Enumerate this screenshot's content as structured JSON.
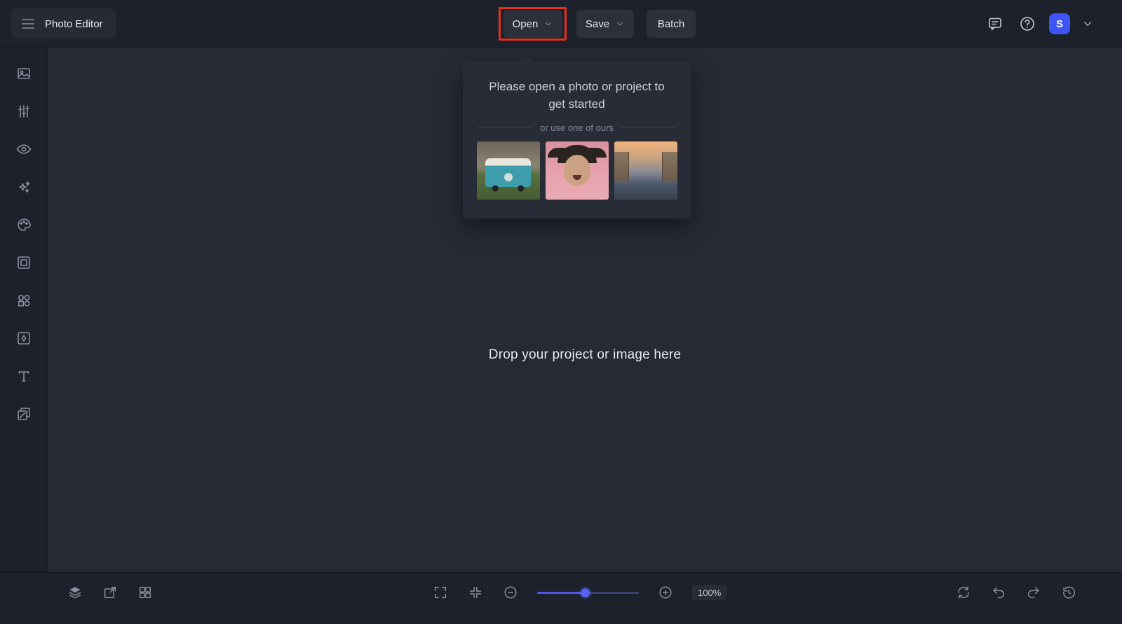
{
  "colors": {
    "topbar_bg": "#1d212b",
    "canvas_bg": "#262a34",
    "popup_bg": "#272c37",
    "button_bg": "#2b303b",
    "accent_blue": "#4a57e8",
    "avatar_blue": "#3d55f2",
    "annotation_red": "#e72f1d",
    "text_primary": "#e7e9ee",
    "text_muted": "#858b99",
    "icon_color": "#7d8492"
  },
  "header": {
    "app_title": "Photo Editor",
    "open_button": "Open",
    "save_button": "Save",
    "batch_button": "Batch",
    "avatar_letter": "S",
    "icons": [
      "hamburger-icon",
      "chevron-down-icon",
      "feedback-icon",
      "help-icon",
      "account-chevron-icon"
    ]
  },
  "sidebar": {
    "tools": [
      {
        "name": "image-tool",
        "icon": "image-icon"
      },
      {
        "name": "adjust-tool",
        "icon": "sliders-icon"
      },
      {
        "name": "retouch-tool",
        "icon": "eye-icon"
      },
      {
        "name": "effects-tool",
        "icon": "sparkles-icon"
      },
      {
        "name": "paint-tool",
        "icon": "palette-icon"
      },
      {
        "name": "frame-tool",
        "icon": "frame-icon"
      },
      {
        "name": "elements-tool",
        "icon": "shapes-icon"
      },
      {
        "name": "filter-tool",
        "icon": "photo-effect-icon"
      },
      {
        "name": "text-tool",
        "icon": "text-icon"
      },
      {
        "name": "layers-tool",
        "icon": "duplicate-icon"
      }
    ]
  },
  "popup": {
    "message": "Please open a photo or project to get started",
    "divider_label": "or use one of ours",
    "samples": [
      {
        "name": "vw-bus-sample"
      },
      {
        "name": "portrait-sample"
      },
      {
        "name": "venice-canal-sample"
      }
    ]
  },
  "canvas": {
    "drop_message": "Drop your project or image here"
  },
  "footer": {
    "zoom_value": "100%",
    "left_icons": [
      "layers-icon",
      "transform-icon",
      "grid-icon"
    ],
    "center_icons": [
      "fullscreen-icon",
      "fit-screen-icon",
      "zoom-out-icon",
      "zoom-in-icon"
    ],
    "right_icons": [
      "refresh-icon",
      "undo-icon",
      "redo-icon",
      "history-icon"
    ]
  }
}
